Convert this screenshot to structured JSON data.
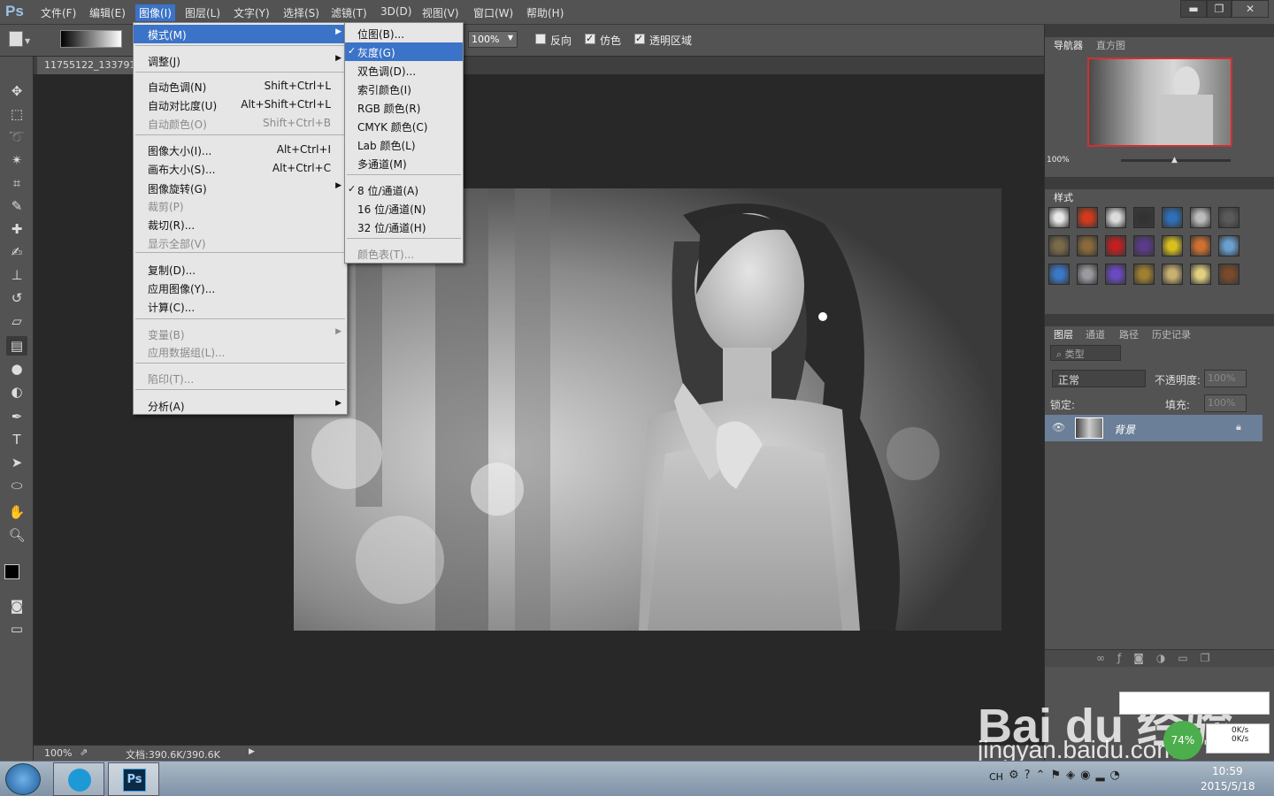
{
  "app": {
    "logo": "Ps"
  },
  "menubar": {
    "items": [
      "文件(F)",
      "编辑(E)",
      "图像(I)",
      "图层(L)",
      "文字(Y)",
      "选择(S)",
      "滤镜(T)",
      "3D(D)",
      "视图(V)",
      "窗口(W)",
      "帮助(H)"
    ],
    "active": "图像(I)"
  },
  "window": {
    "min": "▬",
    "restore": "❐",
    "close": "✕"
  },
  "options": {
    "zoom": "100%",
    "reverse": "反向",
    "dither": "仿色",
    "transparency": "透明区域"
  },
  "document": {
    "tab": "11755122_133791",
    "zoom": "100%",
    "info": "文档:390.6K/390.6K"
  },
  "image_menu": {
    "items": [
      {
        "label": "模式(M)",
        "shortcut": "",
        "submenu": true,
        "disabled": false,
        "highlight": true
      },
      {
        "label": "调整(J)",
        "shortcut": "",
        "submenu": true,
        "disabled": false
      },
      {
        "label": "自动色调(N)",
        "shortcut": "Shift+Ctrl+L",
        "disabled": false
      },
      {
        "label": "自动对比度(U)",
        "shortcut": "Alt+Shift+Ctrl+L",
        "disabled": false
      },
      {
        "label": "自动颜色(O)",
        "shortcut": "Shift+Ctrl+B",
        "disabled": true
      },
      {
        "label": "图像大小(I)...",
        "shortcut": "Alt+Ctrl+I",
        "disabled": false
      },
      {
        "label": "画布大小(S)...",
        "shortcut": "Alt+Ctrl+C",
        "disabled": false
      },
      {
        "label": "图像旋转(G)",
        "shortcut": "",
        "submenu": true,
        "disabled": false
      },
      {
        "label": "裁剪(P)",
        "shortcut": "",
        "disabled": true
      },
      {
        "label": "裁切(R)...",
        "shortcut": "",
        "disabled": false
      },
      {
        "label": "显示全部(V)",
        "shortcut": "",
        "disabled": true
      },
      {
        "label": "复制(D)...",
        "shortcut": "",
        "disabled": false
      },
      {
        "label": "应用图像(Y)...",
        "shortcut": "",
        "disabled": false
      },
      {
        "label": "计算(C)...",
        "shortcut": "",
        "disabled": false
      },
      {
        "label": "变量(B)",
        "shortcut": "",
        "submenu": true,
        "disabled": true
      },
      {
        "label": "应用数据组(L)...",
        "shortcut": "",
        "disabled": true
      },
      {
        "label": "陷印(T)...",
        "shortcut": "",
        "disabled": true
      },
      {
        "label": "分析(A)",
        "shortcut": "",
        "submenu": true,
        "disabled": false
      }
    ]
  },
  "mode_menu": {
    "items": [
      {
        "label": "位图(B)...",
        "checked": false,
        "disabled": false
      },
      {
        "label": "灰度(G)",
        "checked": true,
        "disabled": false,
        "highlight": true
      },
      {
        "label": "双色调(D)...",
        "checked": false,
        "disabled": false
      },
      {
        "label": "索引颜色(I)",
        "checked": false,
        "disabled": false
      },
      {
        "label": "RGB 颜色(R)",
        "checked": false,
        "disabled": false
      },
      {
        "label": "CMYK 颜色(C)",
        "checked": false,
        "disabled": false
      },
      {
        "label": "Lab 颜色(L)",
        "checked": false,
        "disabled": false
      },
      {
        "label": "多通道(M)",
        "checked": false,
        "disabled": false
      },
      {
        "label": "8 位/通道(A)",
        "checked": true,
        "disabled": false
      },
      {
        "label": "16 位/通道(N)",
        "checked": false,
        "disabled": false
      },
      {
        "label": "32 位/通道(H)",
        "checked": false,
        "disabled": false
      },
      {
        "label": "颜色表(T)...",
        "checked": false,
        "disabled": true
      }
    ]
  },
  "navigator": {
    "tabs": [
      "导航器",
      "直方图"
    ],
    "zoom": "100%"
  },
  "styles": {
    "tab": "样式",
    "colors": [
      "#e8e8e8",
      "#d23a1a",
      "#dcdcdc",
      "#333333",
      "#2f6fb8",
      "#bcbcbc",
      "#5a5a5a",
      "#7a6a4a",
      "#8a6a3a",
      "#c02020",
      "#5a3a8a",
      "#d8c020",
      "#d07030",
      "#6aa0d0",
      "#3a78c8",
      "#9a9aa0",
      "#6a4ac0",
      "#a08030",
      "#c8b070",
      "#e0d080",
      "#7a4a2a"
    ]
  },
  "layers": {
    "tabs": [
      "图层",
      "通道",
      "路径",
      "历史记录"
    ],
    "filter": "类型",
    "blend": "正常",
    "opacity_label": "不透明度:",
    "opacity": "100%",
    "lock_label": "锁定:",
    "fill_label": "填充:",
    "fill": "100%",
    "layer_name": "背景"
  },
  "taskbar": {
    "lang": "CH",
    "time": "10:59",
    "date": "2015/5/18"
  },
  "baidu": {
    "logo": "Bai du 经验",
    "url": "jingyan.baidu.com",
    "net_pct": "74%",
    "up": "0K/s",
    "down": "0K/s"
  }
}
